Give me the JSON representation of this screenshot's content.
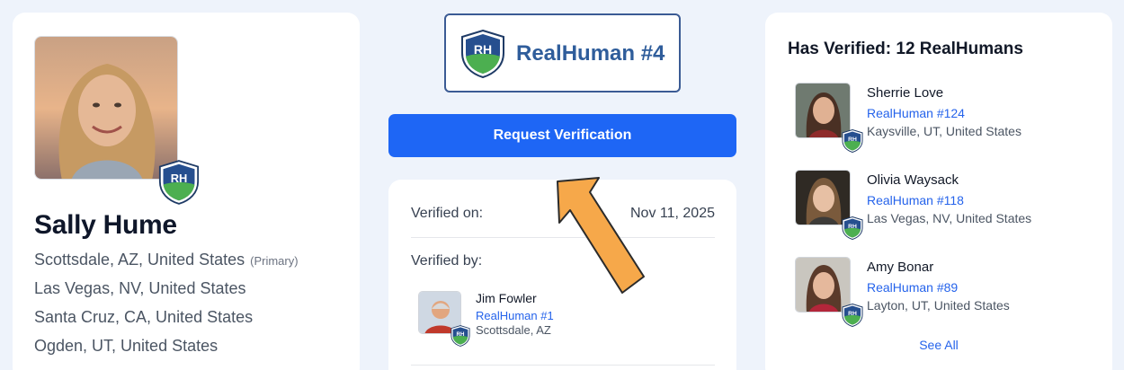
{
  "colors": {
    "page_bg": "#eef3fb",
    "accent_blue": "#1e66f5",
    "link_blue": "#2563eb",
    "badge_blue": "#2f5d9b",
    "arrow_orange": "#f6a84a"
  },
  "badge_icon_text": "RH",
  "profile": {
    "name": "Sally Hume",
    "locations": [
      {
        "text": "Scottsdale, AZ, United States",
        "tag": "(Primary)"
      },
      {
        "text": "Las Vegas, NV, United States"
      },
      {
        "text": "Santa Cruz, CA, United States"
      },
      {
        "text": "Ogden, UT, United States"
      }
    ]
  },
  "badge": {
    "title": "RealHuman #4"
  },
  "request_button": {
    "label": "Request Verification"
  },
  "verification": {
    "verified_on_label": "Verified on:",
    "verified_on_date": "Nov 11, 2025",
    "verified_by_label": "Verified by:",
    "verifier": {
      "name": "Jim Fowler",
      "realhuman": "RealHuman #1",
      "location": "Scottsdale, AZ"
    }
  },
  "has_verified": {
    "title": "Has Verified: 12 RealHumans",
    "people": [
      {
        "name": "Sherrie Love",
        "realhuman": "RealHuman #124",
        "location": "Kaysville, UT, United States"
      },
      {
        "name": "Olivia Waysack",
        "realhuman": "RealHuman #118",
        "location": "Las Vegas, NV, United States"
      },
      {
        "name": "Amy Bonar",
        "realhuman": "RealHuman #89",
        "location": "Layton, UT, United States"
      }
    ],
    "see_all_label": "See All"
  }
}
